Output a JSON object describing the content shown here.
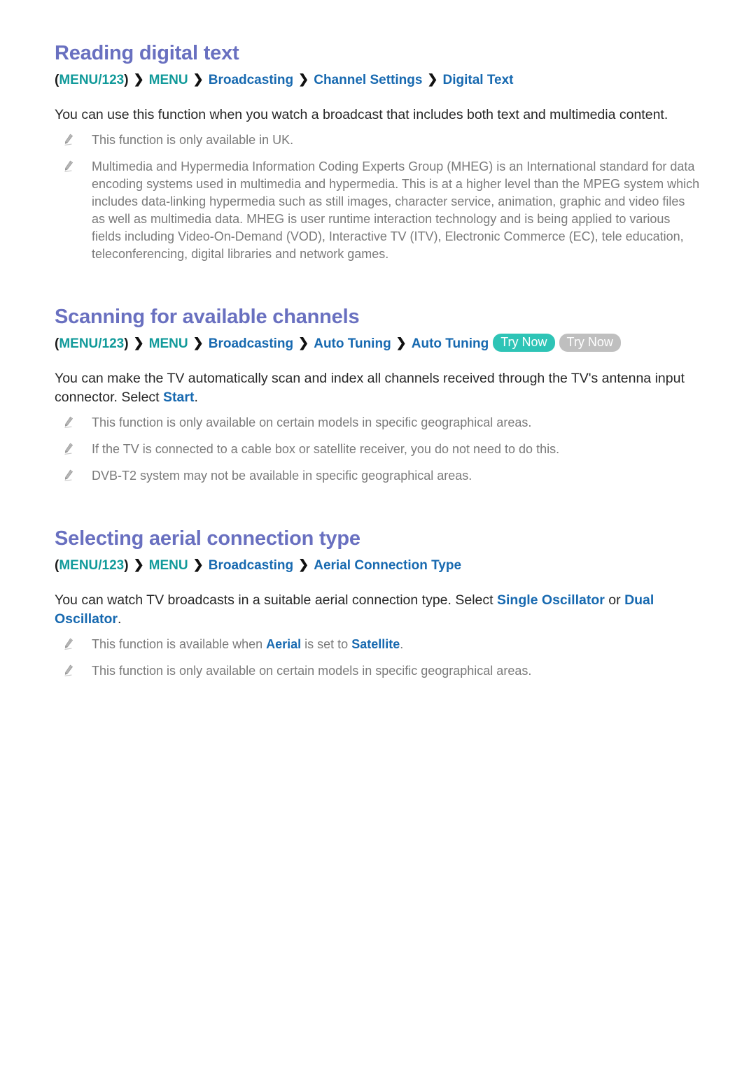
{
  "document": {
    "type": "e-manual-page",
    "background_color": "#ffffff",
    "heading_color": "#6970c0",
    "link_color": "#1769b0",
    "teal_color": "#119a9a",
    "note_color": "#7a7a7a",
    "badge_teal_color": "#2ec4b6",
    "badge_gray_color": "#bfbfbf"
  },
  "sections": [
    {
      "id": "reading-digital-text",
      "title": "Reading digital text",
      "breadcrumb": {
        "open_paren": "(",
        "close_paren": ")",
        "items": [
          {
            "label": "MENU/123",
            "style": "teal"
          },
          {
            "label": "MENU",
            "style": "teal"
          },
          {
            "label": "Broadcasting",
            "style": "blue"
          },
          {
            "label": "Channel Settings",
            "style": "blue"
          },
          {
            "label": "Digital Text",
            "style": "blue"
          }
        ],
        "separator": "❯",
        "badges": []
      },
      "paragraphs": [
        {
          "parts": [
            {
              "text": "You can use this function when you watch a broadcast that includes both text and multimedia content.",
              "style": "plain"
            }
          ]
        }
      ],
      "notes": [
        {
          "icon": "pencil-icon",
          "parts": [
            {
              "text": "This function is only available in UK.",
              "style": "plain"
            }
          ]
        },
        {
          "icon": "pencil-icon",
          "parts": [
            {
              "text": "Multimedia and Hypermedia Information Coding Experts Group (MHEG) is an International standard for data encoding systems used in multimedia and hypermedia. This is at a higher level than the MPEG system which includes data-linking hypermedia such as still images, character service, animation, graphic and video files as well as multimedia data. MHEG is user runtime interaction technology and is being applied to various fields including Video-On-Demand (VOD), Interactive TV (ITV), Electronic Commerce (EC), tele education, teleconferencing, digital libraries and network games.",
              "style": "plain"
            }
          ]
        }
      ]
    },
    {
      "id": "scanning-for-available-channels",
      "title": "Scanning for available channels",
      "breadcrumb": {
        "open_paren": "(",
        "close_paren": ")",
        "items": [
          {
            "label": "MENU/123",
            "style": "teal"
          },
          {
            "label": "MENU",
            "style": "teal"
          },
          {
            "label": "Broadcasting",
            "style": "blue"
          },
          {
            "label": "Auto Tuning",
            "style": "blue"
          },
          {
            "label": "Auto Tuning",
            "style": "blue"
          }
        ],
        "separator": "❯",
        "badges": [
          {
            "label": "Try Now",
            "color": "teal"
          },
          {
            "label": "Try Now",
            "color": "gray"
          }
        ]
      },
      "paragraphs": [
        {
          "parts": [
            {
              "text": "You can make the TV automatically scan and index all channels received through the TV's antenna input connector. Select ",
              "style": "plain"
            },
            {
              "text": "Start",
              "style": "highlight"
            },
            {
              "text": ".",
              "style": "plain"
            }
          ]
        }
      ],
      "notes": [
        {
          "icon": "pencil-icon",
          "parts": [
            {
              "text": "This function is only available on certain models in specific geographical areas.",
              "style": "plain"
            }
          ]
        },
        {
          "icon": "pencil-icon",
          "parts": [
            {
              "text": "If the TV is connected to a cable box or satellite receiver, you do not need to do this.",
              "style": "plain"
            }
          ]
        },
        {
          "icon": "pencil-icon",
          "parts": [
            {
              "text": "DVB-T2 system may not be available in specific geographical areas.",
              "style": "plain"
            }
          ]
        }
      ]
    },
    {
      "id": "selecting-aerial-connection-type",
      "title": "Selecting aerial connection type",
      "breadcrumb": {
        "open_paren": "(",
        "close_paren": ")",
        "items": [
          {
            "label": "MENU/123",
            "style": "teal"
          },
          {
            "label": "MENU",
            "style": "teal"
          },
          {
            "label": "Broadcasting",
            "style": "blue"
          },
          {
            "label": "Aerial Connection Type",
            "style": "blue"
          }
        ],
        "separator": "❯",
        "badges": []
      },
      "paragraphs": [
        {
          "parts": [
            {
              "text": "You can watch TV broadcasts in a suitable aerial connection type. Select ",
              "style": "plain"
            },
            {
              "text": "Single Oscillator",
              "style": "highlight"
            },
            {
              "text": " or ",
              "style": "plain"
            },
            {
              "text": "Dual Oscillator",
              "style": "highlight"
            },
            {
              "text": ".",
              "style": "plain"
            }
          ]
        }
      ],
      "notes": [
        {
          "icon": "pencil-icon",
          "parts": [
            {
              "text": "This function is available when ",
              "style": "plain"
            },
            {
              "text": "Aerial",
              "style": "highlight"
            },
            {
              "text": " is set to ",
              "style": "plain"
            },
            {
              "text": "Satellite",
              "style": "highlight"
            },
            {
              "text": ".",
              "style": "plain"
            }
          ]
        },
        {
          "icon": "pencil-icon",
          "parts": [
            {
              "text": "This function is only available on certain models in specific geographical areas.",
              "style": "plain"
            }
          ]
        }
      ]
    }
  ]
}
